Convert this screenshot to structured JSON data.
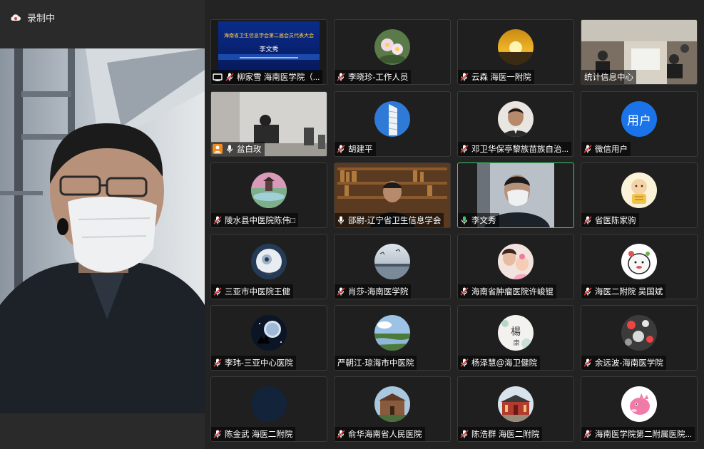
{
  "recording": {
    "label": "录制中"
  },
  "slide": {
    "title": "海南省卫生信息学会第二届会员代表大会",
    "speaker": "李文秀"
  },
  "participants": [
    {
      "name": "柳家雪 海南医学院（...",
      "icon": "screen-share-icon"
    },
    {
      "name": "李晓珍-工作人员",
      "icon": "mic-muted-icon"
    },
    {
      "name": "云森 海医一附院",
      "icon": "mic-muted-icon"
    },
    {
      "name": "统计信息中心",
      "icon": "none"
    },
    {
      "name": "盆白玫",
      "icon": "mic-icon"
    },
    {
      "name": "胡建平",
      "icon": "mic-muted-icon"
    },
    {
      "name": "邓卫华保亭黎族苗族自治...",
      "icon": "mic-muted-icon"
    },
    {
      "name": "微信用户",
      "icon": "mic-muted-icon",
      "avatar_text": "用户"
    },
    {
      "name": "陵水县中医院陈伟□",
      "icon": "mic-muted-icon"
    },
    {
      "name": "邵尉-辽宁省卫生信息学会",
      "icon": "mic-icon"
    },
    {
      "name": "李文秀",
      "icon": "mic-active-icon"
    },
    {
      "name": "省医陈家驹",
      "icon": "mic-muted-icon"
    },
    {
      "name": "三亚市中医院王健",
      "icon": "mic-muted-icon"
    },
    {
      "name": "肖莎-海南医学院",
      "icon": "mic-muted-icon"
    },
    {
      "name": "海南省肿瘤医院许峻锟",
      "icon": "mic-muted-icon"
    },
    {
      "name": "海医二附院 吴国斌",
      "icon": "mic-muted-icon"
    },
    {
      "name": "李玮-三亚中心医院",
      "icon": "mic-muted-icon"
    },
    {
      "name": "严朝江-琼海市中医院",
      "icon": "none"
    },
    {
      "name": "杨泽慧@海卫健院",
      "icon": "mic-muted-icon"
    },
    {
      "name": "余远波-海南医学院",
      "icon": "mic-muted-icon"
    },
    {
      "name": "陈金武 海医二附院",
      "icon": "mic-muted-icon"
    },
    {
      "name": "俞华海南省人民医院",
      "icon": "mic-muted-icon"
    },
    {
      "name": "陈浩群 海医二附院",
      "icon": "mic-muted-icon"
    },
    {
      "name": "海南医学院第二附属医院...",
      "icon": "mic-muted-icon"
    }
  ],
  "colors": {
    "active_border": "#3ec96a",
    "accent_blue": "#1a73e8",
    "muted_red": "#e03b3b"
  }
}
